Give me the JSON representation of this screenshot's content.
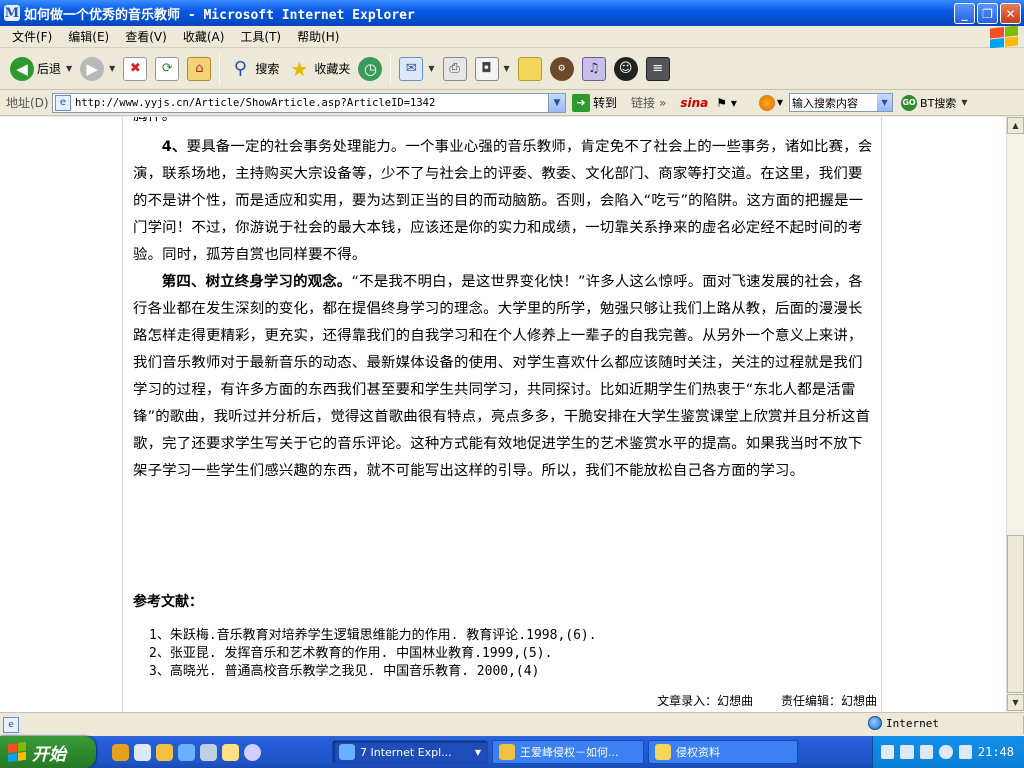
{
  "window": {
    "title": "如何做一个优秀的音乐教师 - Microsoft Internet Explorer",
    "icon_letter": "M"
  },
  "menu": [
    "文件(F)",
    "编辑(E)",
    "查看(V)",
    "收藏(A)",
    "工具(T)",
    "帮助(H)"
  ],
  "toolbar": {
    "back_label": "后退",
    "search_label": "搜索",
    "favorites_label": "收藏夹"
  },
  "address": {
    "label": "地址(D)",
    "url": "http://www.yyjs.cn/Article/ShowArticle.asp?ArticleID=1342",
    "go_label": "转到",
    "links_label": "链接",
    "sina_label": "sina",
    "search_placeholder": "输入搜索内容",
    "bt_label": "BT搜索"
  },
  "article": {
    "cutoff_text": "胸怀。",
    "p4_bold": "4、",
    "p4_text": "要具备一定的社会事务处理能力。一个事业心强的音乐教师，肯定免不了社会上的一些事务，诸如比赛，会演，联系场地，主持购买大宗设备等，少不了与社会上的评委、教委、文化部门、商家等打交道。在这里，我们要的不是讲个性，而是适应和实用，要为达到正当的目的而动脑筋。否则，会陷入“吃亏”的陷阱。这方面的把握是一门学问！不过，你游说于社会的最大本钱，应该还是你的实力和成绩，一切靠关系挣来的虚名必定经不起时间的考验。同时，孤芳自赏也同样要不得。",
    "p5_bold": "第四、树立终身学习的观念。",
    "p5_text": "“不是我不明白，是这世界变化快！”许多人这么惊呼。面对飞速发展的社会，各行各业都在发生深刻的变化，都在提倡终身学习的理念。大学里的所学，勉强只够让我们上路从教，后面的漫漫长路怎样走得更精彩，更充实，还得靠我们的自我学习和在个人修养上一辈子的自我完善。从另外一个意义上来讲，我们音乐教师对于最新音乐的动态、最新媒体设备的使用、对学生喜欢什么都应该随时关注，关注的过程就是我们学习的过程，有许多方面的东西我们甚至要和学生共同学习，共同探讨。比如近期学生们热衷于“东北人都是活雷锋”的歌曲，我听过并分析后，觉得这首歌曲很有特点，亮点多多，干脆安排在大学生鉴赏课堂上欣赏并且分析这首歌，完了还要求学生写关于它的音乐评论。这种方式能有效地促进学生的艺术鉴赏水平的提高。如果我当时不放下架子学习一些学生们感兴趣的东西，就不可能写出这样的引导。所以，我们不能放松自己各方面的学习。",
    "refs_title": "参考文献：",
    "refs": [
      "1、朱跃梅.音乐教育对培养学生逻辑思维能力的作用. 教育评论.1998,(6).",
      "2、张亚昆. 发挥音乐和艺术教育的作用.  中国林业教育.1999,(5).",
      "3、高晓光. 普通高校音乐教学之我见. 中国音乐教育. 2000,(4)"
    ],
    "entry_by": "文章录入：幻想曲",
    "editor": "责任编辑：幻想曲"
  },
  "status": {
    "zone": "Internet"
  },
  "taskbar": {
    "start_label": "开始",
    "tasks": [
      {
        "label": "7 Internet Expl...",
        "active": true
      },
      {
        "label": "王爱峰侵权－如何...",
        "active": false
      },
      {
        "label": "侵权资料",
        "active": false
      }
    ],
    "clock": "21:48"
  },
  "colors": {
    "title_bar": "#0a5ae6",
    "taskbar": "#245edb",
    "start_button": "#2e8b2e",
    "tray": "#0c7ed6"
  },
  "icons": [
    "back-icon",
    "forward-icon",
    "stop-icon",
    "refresh-icon",
    "home-icon",
    "search-icon",
    "favorites-icon",
    "history-icon",
    "mail-icon",
    "print-icon",
    "edit-icon",
    "messenger-icon",
    "go-icon",
    "globe-icon",
    "windows-flag-icon"
  ]
}
